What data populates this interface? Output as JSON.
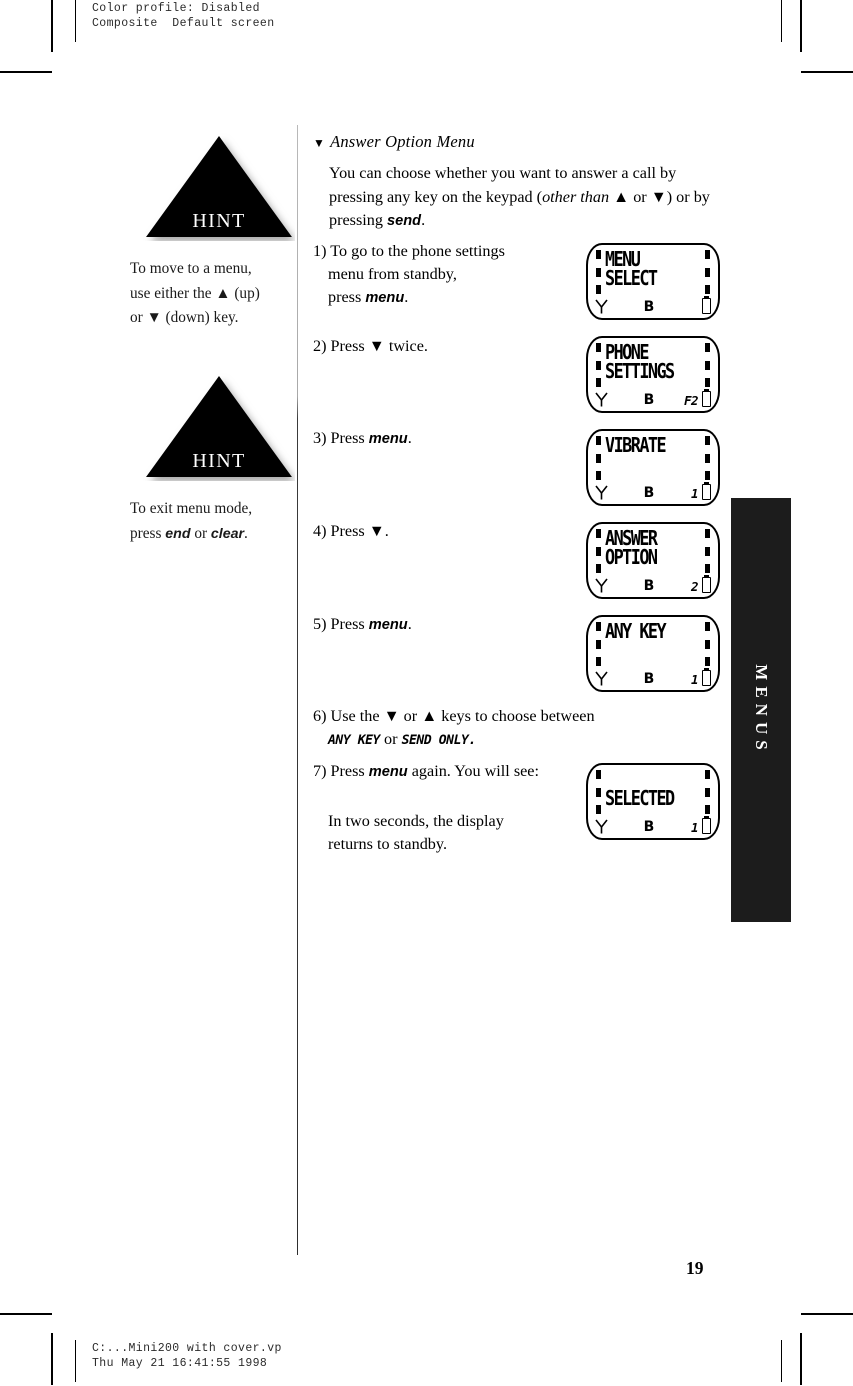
{
  "proof": {
    "top_line1": "Color profile: Disabled",
    "top_line2": "Composite  Default screen",
    "bottom_line1": "C:...Mini200 with cover.vp",
    "bottom_line2": "Thu May 21 16:41:55 1998"
  },
  "sidebar": {
    "hints": [
      {
        "badge": "HINT",
        "text_html": "To move to a menu, use either the ▲ (up) or ▼ (down) key.",
        "line1": "To move to a menu,",
        "line2_a": "use either the ",
        "line2_up": "▲",
        "line2_b": " (up)",
        "line3_a": "or ",
        "line3_down": "▼",
        "line3_b": " (down) key."
      },
      {
        "badge": "HINT",
        "line1": "To exit menu mode,",
        "line2_a": "press ",
        "line2_key1": "end",
        "line2_b": " or ",
        "line2_key2": "clear",
        "line2_c": "."
      }
    ]
  },
  "main": {
    "heading_marker": "▼",
    "heading": "Answer Option Menu",
    "intro": {
      "part1": "You can choose whether you want to answer a call by pressing any key on the keypad (",
      "emph": "other than",
      "part2": " ▲ or ▼) or by pressing ",
      "key": "send",
      "part3": "."
    },
    "steps": [
      {
        "num": "1)",
        "line1": "To go to the phone settings",
        "line2": "menu from standby,",
        "line3_a": "press ",
        "line3_key": "menu",
        "line3_b": "."
      },
      {
        "num": "2)",
        "line1_a": "Press ",
        "line1_arrow": "▼",
        "line1_b": " twice."
      },
      {
        "num": "3)",
        "line1_a": "Press ",
        "line1_key": "menu",
        "line1_b": "."
      },
      {
        "num": "4)",
        "line1_a": "Press ",
        "line1_arrow": "▼",
        "line1_b": "."
      },
      {
        "num": "5)",
        "line1_a": "Press ",
        "line1_key": "menu",
        "line1_b": "."
      },
      {
        "num": "6)",
        "line1_a": "Use the ",
        "line1_down": "▼",
        "line1_b": " or ",
        "line1_up": "▲",
        "line1_c": " keys to choose between",
        "line2_opt1": "ANY KEY",
        "line2_mid": " or ",
        "line2_opt2": "SEND ONLY."
      },
      {
        "num": "7)",
        "line1_a": "Press ",
        "line1_key": "menu",
        "line1_b": " again. You will see:",
        "line2": "In two seconds, the display",
        "line3": "returns to standby."
      }
    ]
  },
  "lcd_screens": [
    {
      "name": "menu-select",
      "row1": "MENU",
      "row2": "SELECT",
      "status_b": "B",
      "index": "",
      "battery": true,
      "antenna": true
    },
    {
      "name": "phone-settings",
      "row1": "PHONE",
      "row2": "SETTINGS",
      "status_b": "B",
      "index": "F2",
      "battery": true,
      "antenna": true
    },
    {
      "name": "vibrate",
      "row1": "VIBRATE",
      "row2": "",
      "status_b": "B",
      "index": "1",
      "battery": true,
      "antenna": true
    },
    {
      "name": "answer-option",
      "row1": "ANSWER",
      "row2": "OPTION",
      "status_b": "B",
      "index": "2",
      "battery": true,
      "antenna": true
    },
    {
      "name": "any-key",
      "row1": "ANY KEY",
      "row2": "",
      "status_b": "B",
      "index": "1",
      "battery": true,
      "antenna": true
    },
    {
      "name": "selected",
      "row1": "",
      "row2": "SELECTED",
      "status_b": "B",
      "index": "1",
      "battery": true,
      "antenna": true
    }
  ],
  "tab": {
    "label": "MENUS"
  },
  "folio": {
    "page_number": "19"
  },
  "colors": {
    "tab_background": "#1c1c1c",
    "text": "#000000",
    "page_background": "#ffffff"
  }
}
